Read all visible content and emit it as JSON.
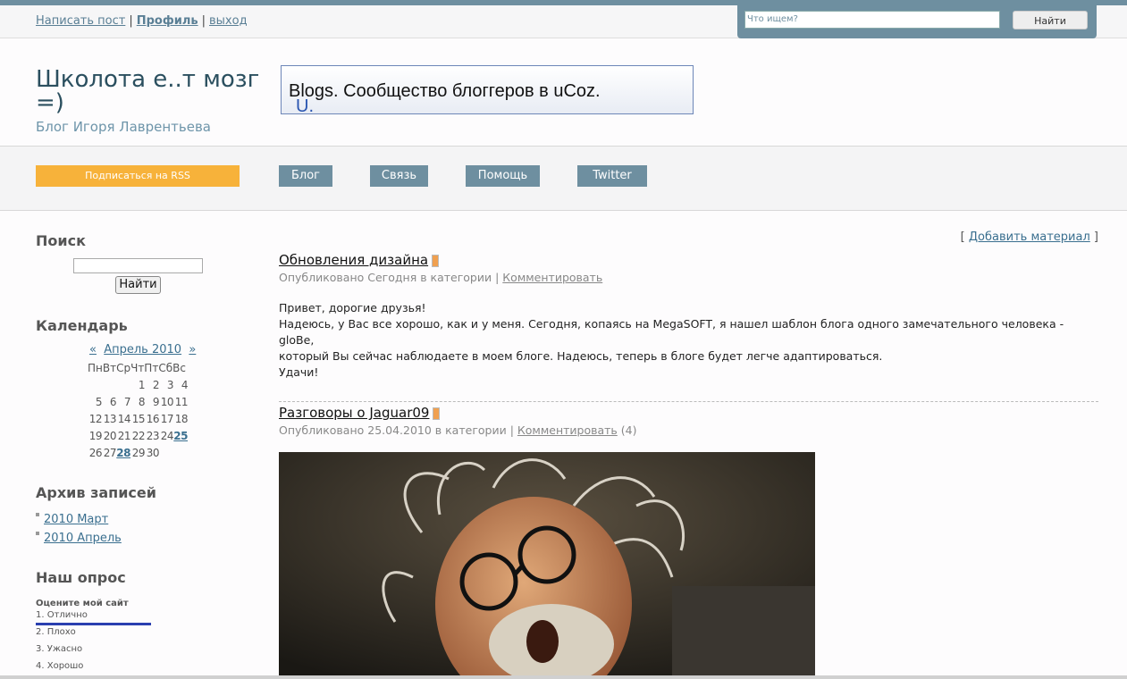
{
  "topbar": {
    "links": [
      "Написать пост",
      "Профиль",
      "выход"
    ],
    "search_placeholder": "Что ищем?",
    "search_button": "Найти"
  },
  "header": {
    "title": "Школота е..т мозг =)",
    "subtitle": "Блог Игоря Лаврентьева",
    "banner_u": "U.",
    "banner_text": "Blogs. Сообщество блоггеров в uCoz."
  },
  "nav": {
    "rss": "Подписаться на RSS",
    "items": [
      "Блог",
      "Связь",
      "Помощь",
      "Twitter"
    ]
  },
  "sidebar": {
    "search_title": "Поиск",
    "search_button": "Найти",
    "calendar_title": "Календарь",
    "calendar": {
      "prev": "«",
      "month": "Апрель 2010",
      "next": "»",
      "weekdays": "ПнВтСрЧтПтСбВс",
      "rows": [
        [
          "",
          "",
          "",
          "1",
          "2",
          "3",
          "4"
        ],
        [
          "5",
          "6",
          "7",
          "8",
          "9",
          "10",
          "11"
        ],
        [
          "12",
          "13",
          "14",
          "15",
          "16",
          "17",
          "18"
        ],
        [
          "19",
          "20",
          "21",
          "22",
          "23",
          "24",
          "25"
        ],
        [
          "26",
          "27",
          "28",
          "29",
          "30",
          "",
          ""
        ]
      ],
      "linked_days": [
        "25",
        "28"
      ]
    },
    "archive_title": "Архив записей",
    "archive": [
      "2010 Март",
      "2010 Апрель"
    ],
    "poll_title": "Наш опрос",
    "poll_question": "Оцените мой сайт",
    "poll_options": [
      "1. Отлично",
      "2. Плохо",
      "3. Ужасно",
      "4. Хорошо"
    ]
  },
  "content": {
    "add_material": "Добавить материал",
    "posts": [
      {
        "title": "Обновления дизайна",
        "meta_prefix": "Опубликовано Сегодня в категории",
        "comment": "Комментировать",
        "comment_count": "",
        "body_lines": [
          "Привет, дорогие друзья!",
          "Надеюсь, у Вас все хорошо, как и у меня. Сегодня, копаясь на MegaSOFT, я нашел шаблон блога одного замечательного человека - gloBe,",
          "который Вы сейчас наблюдаете в моем блоге. Надеюсь, теперь в блоге будет легче адаптироваться.",
          "Удачи!"
        ]
      },
      {
        "title": "Разговоры о Jaguar09",
        "meta_prefix": "Опубликовано 25.04.2010 в категории",
        "comment": "Комментировать",
        "comment_count": "(4)"
      }
    ]
  },
  "colors": {
    "accent": "#6e8fa0",
    "rss": "#f7b23a",
    "link": "#3a6f8f"
  }
}
